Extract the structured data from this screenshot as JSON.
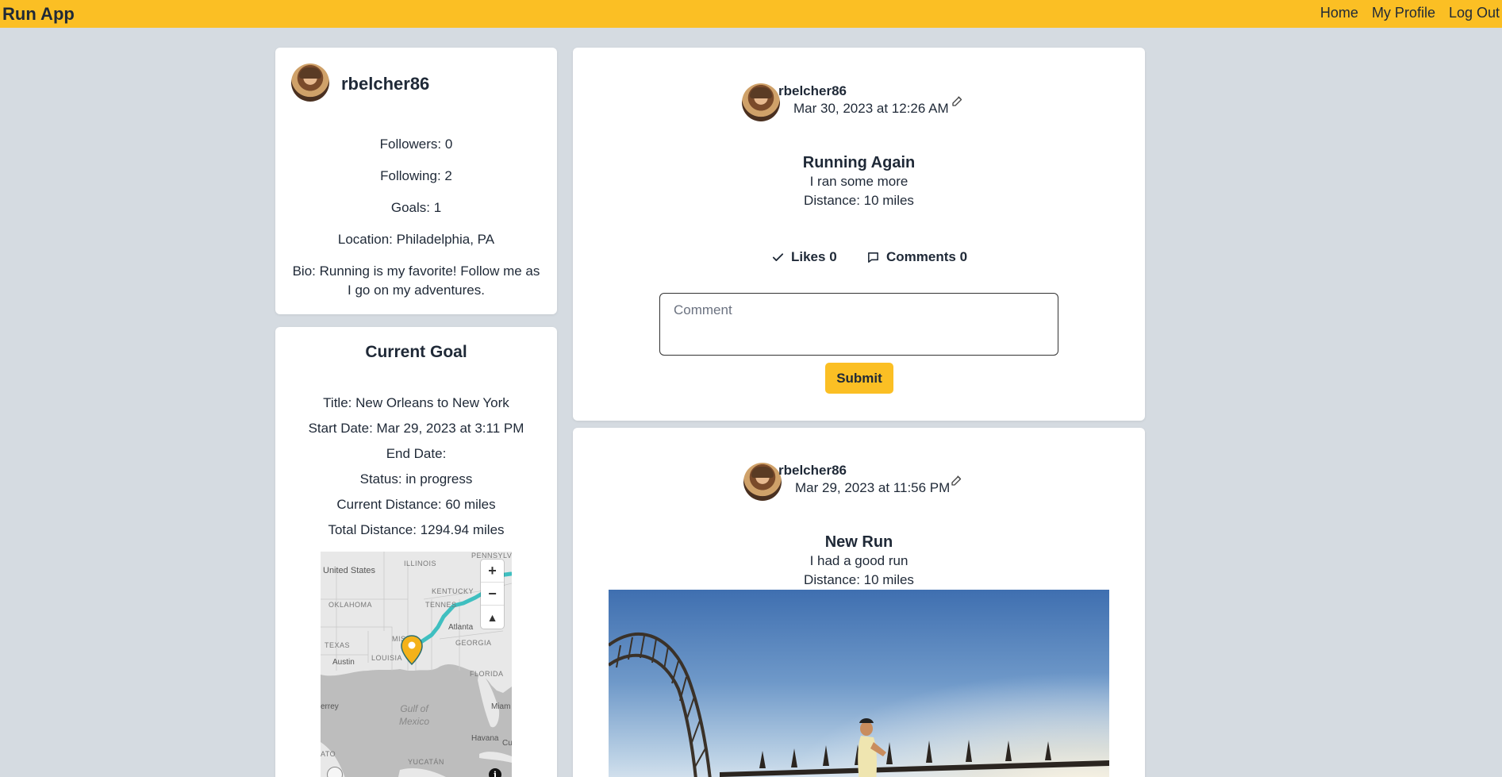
{
  "navbar": {
    "brand": "Run App",
    "links": [
      "Home",
      "My Profile",
      "Log Out"
    ]
  },
  "profile": {
    "username": "rbelcher86",
    "followers": "Followers: 0",
    "following": "Following: 2",
    "goals": "Goals: 1",
    "location": "Location: Philadelphia, PA",
    "bio": "Bio: Running is my favorite! Follow me as I go on my adventures."
  },
  "goal": {
    "heading": "Current Goal",
    "title": "Title: New Orleans to New York",
    "start_date": "Start Date: Mar 29, 2023 at 3:11 PM",
    "end_date": "End Date:",
    "status": "Status: in progress",
    "current_distance": "Current Distance: 60 miles",
    "total_distance": "Total Distance: 1294.94 miles",
    "map": {
      "labels": {
        "united_states": "United States",
        "illinois": "ILLINOIS",
        "pennsylvania": "PENNSYLV",
        "kentucky": "KENTUCKY",
        "oklahoma": "OKLAHOMA",
        "tennessee": "TENNES",
        "atlanta": "Atlanta",
        "mississippi": "MISSIS",
        "georgia": "GEORGIA",
        "texas": "TEXAS",
        "austin": "Austin",
        "louisiana": "LOUISIA",
        "florida": "FLORIDA",
        "gulf": "Gulf of Mexico",
        "terrey": "errey",
        "miami": "Miam",
        "havana": "Havana",
        "cuba": "Cu",
        "yucatan": "YUCATÁN",
        "ato": "ATO"
      },
      "zoom_in": "+",
      "zoom_out": "−",
      "compass": "▲",
      "info": "i"
    }
  },
  "posts": [
    {
      "username": "rbelcher86",
      "date": "Mar 30, 2023 at 12:26 AM",
      "title": "Running Again",
      "description": "I ran some more",
      "distance": "Distance: 10 miles",
      "likes": "Likes 0",
      "comments": "Comments 0",
      "comment_placeholder": "Comment",
      "submit": "Submit"
    },
    {
      "username": "rbelcher86",
      "date": "Mar 29, 2023 at 11:56 PM",
      "title": "New Run",
      "description": "I had a good run",
      "distance": "Distance: 10 miles"
    }
  ],
  "colors": {
    "accent": "#fbbf24",
    "background": "#d5dbe1",
    "card": "#ffffff",
    "route": "#3fbfc0",
    "pin": "#f4b21a"
  }
}
